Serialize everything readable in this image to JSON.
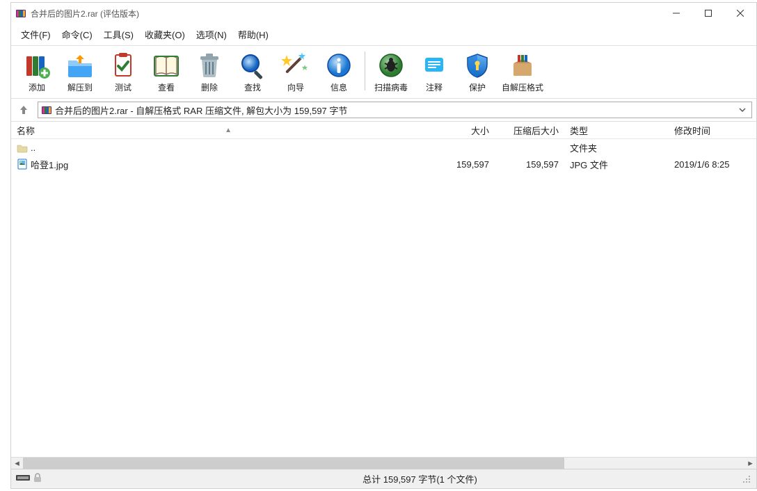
{
  "titlebar": {
    "title": "合并后的图片2.rar (评估版本)"
  },
  "menu": {
    "file": "文件(F)",
    "commands": "命令(C)",
    "tools": "工具(S)",
    "favorites": "收藏夹(O)",
    "options": "选项(N)",
    "help": "帮助(H)"
  },
  "toolbar": {
    "add": "添加",
    "extract": "解压到",
    "test": "测试",
    "view": "查看",
    "delete": "删除",
    "find": "查找",
    "wizard": "向导",
    "info": "信息",
    "virusscan": "扫描病毒",
    "comment": "注释",
    "protect": "保护",
    "sfx": "自解压格式"
  },
  "path": {
    "text": "合并后的图片2.rar - 自解压格式 RAR 压缩文件, 解包大小为 159,597 字节"
  },
  "columns": {
    "name": "名称",
    "size": "大小",
    "packed": "压缩后大小",
    "type": "类型",
    "modified": "修改时间"
  },
  "rows": [
    {
      "icon": "folder-up",
      "name": "..",
      "size": "",
      "packed": "",
      "type": "文件夹",
      "modified": ""
    },
    {
      "icon": "jpg",
      "name": "哈登1.jpg",
      "size": "159,597",
      "packed": "159,597",
      "type": "JPG 文件",
      "modified": "2019/1/6 8:25"
    }
  ],
  "status": {
    "summary": "总计 159,597 字节(1 个文件)"
  }
}
